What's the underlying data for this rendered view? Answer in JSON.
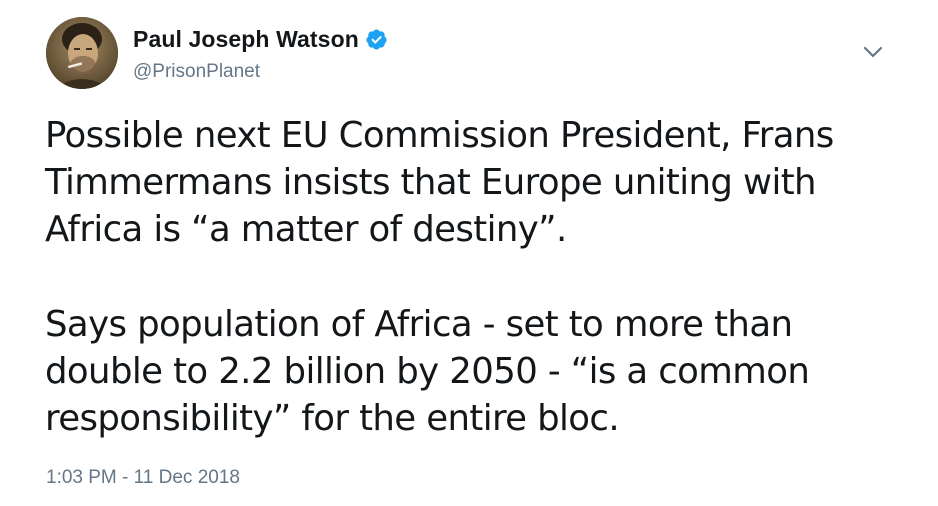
{
  "tweet": {
    "author": {
      "display_name": "Paul Joseph Watson",
      "handle": "@PrisonPlanet",
      "verified": true,
      "verified_icon": "verified-badge-icon",
      "avatar_icon": "avatar"
    },
    "menu_icon": "chevron-down-icon",
    "paragraphs": [
      "Possible next EU Commission President, Frans\nTimmermans insists that Europe uniting with\nAfrica is “a matter of destiny”.",
      "Says population of Africa - set to more than\ndouble to 2.2 billion by 2050 - “is a common\nresponsibility” for the entire bloc."
    ],
    "timestamp": "1:03 PM - 11 Dec 2018"
  },
  "colors": {
    "text": "#14171a",
    "secondary_text": "#657786",
    "verified_blue": "#1da1f2",
    "background": "#ffffff"
  }
}
